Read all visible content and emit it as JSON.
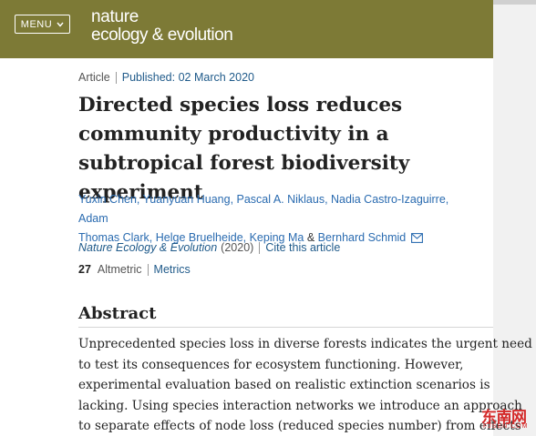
{
  "header": {
    "menu_label": "MENU",
    "logo_line1": "nature",
    "logo_line2": "ecology & evolution",
    "color": "#7d7a36"
  },
  "article_meta": {
    "type": "Article",
    "published": "Published: 02 March 2020"
  },
  "title": "Directed species loss reduces community productivity in a subtropical forest biodiversity experiment",
  "authors": {
    "line1": "Yuxin Chen, Yuanyuan Huang, Pascal A. Niklaus, Nadia Castro-Izaguirre, Adam",
    "line2_names": "Thomas Clark, Helge Bruelheide, Keping Ma",
    "ampersand": "&",
    "last_author": "Bernhard Schmid",
    "mail_icon": "mail-icon"
  },
  "journal": {
    "name": "Nature Ecology & Evolution",
    "year": "(2020)",
    "cite_label": "Cite this article"
  },
  "altmetric": {
    "score": "27",
    "label": "Altmetric",
    "metrics_label": "Metrics"
  },
  "abstract": {
    "heading": "Abstract",
    "lines": [
      "Unprecedented species loss in diverse forests indicates the urgent need",
      "to test its consequences for ecosystem functioning. However,",
      "experimental evaluation based on realistic extinction scenarios is",
      "lacking. Using species interaction networks we introduce an approach",
      "to separate effects of node loss (reduced species number) from effects"
    ]
  },
  "watermark": {
    "text": "东南网",
    "sub": "FJSEN.COM",
    "color": "#d42a2a"
  }
}
